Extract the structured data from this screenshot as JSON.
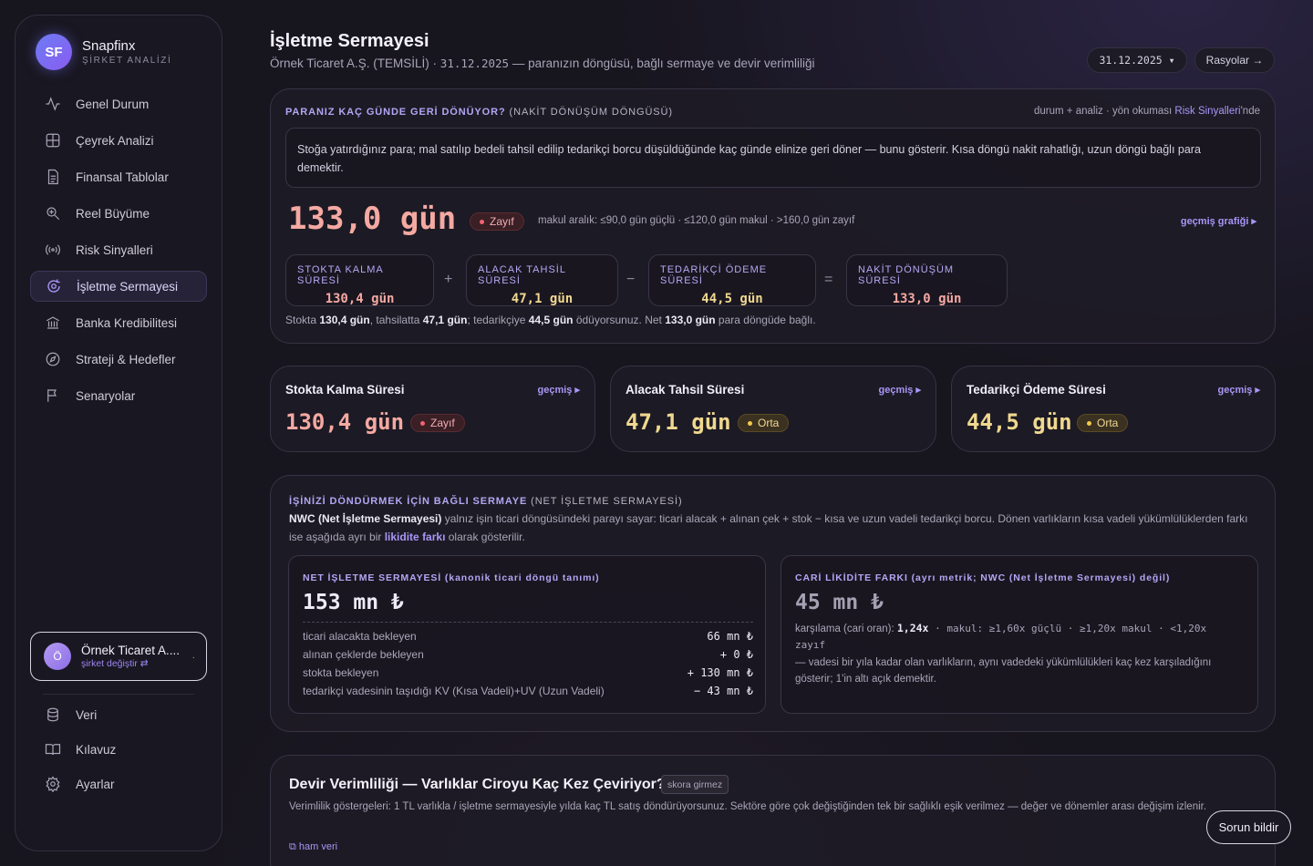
{
  "brand": {
    "initials": "SF",
    "name": "Snapfinx",
    "subtitle": "ŞİRKET ANALİZİ"
  },
  "nav": [
    {
      "label": "Genel Durum",
      "icon": "activity-icon"
    },
    {
      "label": "Çeyrek Analizi",
      "icon": "grid-icon"
    },
    {
      "label": "Finansal Tablolar",
      "icon": "document-icon"
    },
    {
      "label": "Reel Büyüme",
      "icon": "zoom-in-icon"
    },
    {
      "label": "Risk Sinyalleri",
      "icon": "signal-icon"
    },
    {
      "label": "İşletme Sermayesi",
      "icon": "cycle-icon",
      "active": true
    },
    {
      "label": "Banka Kredibilitesi",
      "icon": "bank-icon"
    },
    {
      "label": "Strateji & Hedefler",
      "icon": "compass-icon"
    },
    {
      "label": "Senaryolar",
      "icon": "flag-icon"
    }
  ],
  "company": {
    "initial": "Ö",
    "name": "Örnek Ticaret A....",
    "switch": "şirket değiştir ⇄",
    "menu": "·"
  },
  "nav_bottom": [
    {
      "label": "Veri",
      "icon": "database-icon"
    },
    {
      "label": "Kılavuz",
      "icon": "book-icon"
    },
    {
      "label": "Ayarlar",
      "icon": "settings-icon"
    }
  ],
  "header": {
    "title": "İşletme Sermayesi",
    "subtitle_prefix": "Örnek Ticaret A.Ş. (TEMSİLİ) · ",
    "subtitle_date": "31.12.2025",
    "subtitle_suffix": " — paranızın döngüsü, bağlı sermaye ve devir verimliliği",
    "date_pill": "31.12.2025 ▾",
    "ratios_button": "Rasyolar →"
  },
  "ccc": {
    "title": "PARANIZ KAÇ GÜNDE GERİ DÖNÜYOR?",
    "title_suffix": " (NAKİT DÖNÜŞÜM DÖNGÜSÜ)",
    "note_prefix": "durum + analiz · yön okuması ",
    "note_link": "Risk Sinyalleri",
    "note_suffix": "'nde",
    "description": "Stoğa yatırdığınız para; mal satılıp bedeli tahsil edilip tedarikçi borcu düşüldüğünde kaç günde elinize geri döner — bunu gösterir. Kısa döngü nakit rahatlığı, uzun döngü bağlı para demektir.",
    "value": "133,0 gün",
    "status": "Zayıf",
    "range": "makul aralık: ≤90,0 gün güçlü · ≤120,0 gün makul · >160,0 gün zayıf",
    "history_link": "geçmiş grafiği ▸",
    "components": [
      {
        "label": "STOKTA KALMA SÜRESİ",
        "value": "130,4 gün",
        "color": "#f4a9a2"
      },
      {
        "label": "ALACAK TAHSİL SÜRESİ",
        "value": "47,1 gün",
        "color": "#f0d88f"
      },
      {
        "label": "TEDARİKÇİ ÖDEME SÜRESİ",
        "value": "44,5 gün",
        "color": "#f0d88f"
      },
      {
        "label": "NAKİT DÖNÜŞÜM SÜRESİ",
        "value": "133,0 gün",
        "color": "#f4a9a2"
      }
    ],
    "ops": [
      "+",
      "−",
      "="
    ],
    "summary": [
      {
        "t": "Stokta ",
        "b": false
      },
      {
        "t": "130,4 gün",
        "b": true
      },
      {
        "t": ", tahsilatta ",
        "b": false
      },
      {
        "t": "47,1 gün",
        "b": true
      },
      {
        "t": "; tedarikçiye ",
        "b": false
      },
      {
        "t": "44,5 gün",
        "b": true
      },
      {
        "t": " ödüyorsunuz. Net ",
        "b": false
      },
      {
        "t": "133,0 gün",
        "b": true
      },
      {
        "t": " para döngüde bağlı.",
        "b": false
      }
    ]
  },
  "metrics": [
    {
      "title": "Stokta Kalma Süresi",
      "link": "geçmiş ▸",
      "value": "130,4 gün",
      "status": "Zayıf",
      "level": "bad"
    },
    {
      "title": "Alacak Tahsil Süresi",
      "link": "geçmiş ▸",
      "value": "47,1 gün",
      "status": "Orta",
      "level": "mid"
    },
    {
      "title": "Tedarikçi Ödeme Süresi",
      "link": "geçmiş ▸",
      "value": "44,5 gün",
      "status": "Orta",
      "level": "mid"
    }
  ],
  "nwc": {
    "title": "İŞİNİZİ DÖNDÜRMEK İÇİN BAĞLI SERMAYE",
    "title_suffix": " (NET İŞLETME SERMAYESİ)",
    "desc_bold": "NWC (Net İşletme Sermayesi)",
    "desc_mid": " yalnız işin ticari döngüsündeki parayı sayar: ticari alacak + alınan çek + stok − kısa ve uzun vadeli tedarikçi borcu. Dönen varlıkların kısa vadeli yükümlülüklerden farkı ise aşağıda ayrı bir ",
    "desc_link": "likidite farkı",
    "desc_end": " olarak gösterilir.",
    "left": {
      "title": "NET İŞLETME SERMAYESİ (kanonik ticari döngü tanımı)",
      "value": "153 mn ₺",
      "rows": [
        {
          "label": "ticari alacakta bekleyen",
          "value": "66 mn ₺"
        },
        {
          "label": "alınan çeklerde bekleyen",
          "value": "+ 0 ₺"
        },
        {
          "label": "stokta bekleyen",
          "value": "+ 130 mn ₺"
        },
        {
          "label": "tedarikçi vadesinin taşıdığı KV (Kısa Vadeli)+UV (Uzun Vadeli)",
          "value": "− 43 mn ₺"
        }
      ]
    },
    "right": {
      "title": "CARİ LİKİDİTE FARKI (ayrı metrik; NWC (Net İşletme Sermayesi) değil)",
      "value": "45 mn ₺",
      "ratio_prefix": "karşılama (cari oran): ",
      "ratio": "1,24x",
      "ratio_thresholds": " · makul: ≥1,60x güçlü · ≥1,20x makul · <1,20x zayıf",
      "note": "— vadesi bir yıla kadar olan varlıkların, aynı vadedeki yükümlülükleri kaç kez karşıladığını gösterir; 1'in altı açık demektir."
    }
  },
  "turnover": {
    "title": "Devir Verimliliği — Varlıklar Ciroyu Kaç Kez Çeviriyor?",
    "tag": "skora girmez",
    "desc": "Verimlilik göstergeleri: 1 TL varlıkla / işletme sermayesiyle yılda kaç TL satış döndürüyorsunuz. Sektöre göre çok değiştiğinden tek bir sağlıklı eşik verilmez — değer ve dönemler arası değişim izlenir.",
    "raw_link": "⧉ ham veri"
  },
  "feedback_button": "Sorun bildir"
}
